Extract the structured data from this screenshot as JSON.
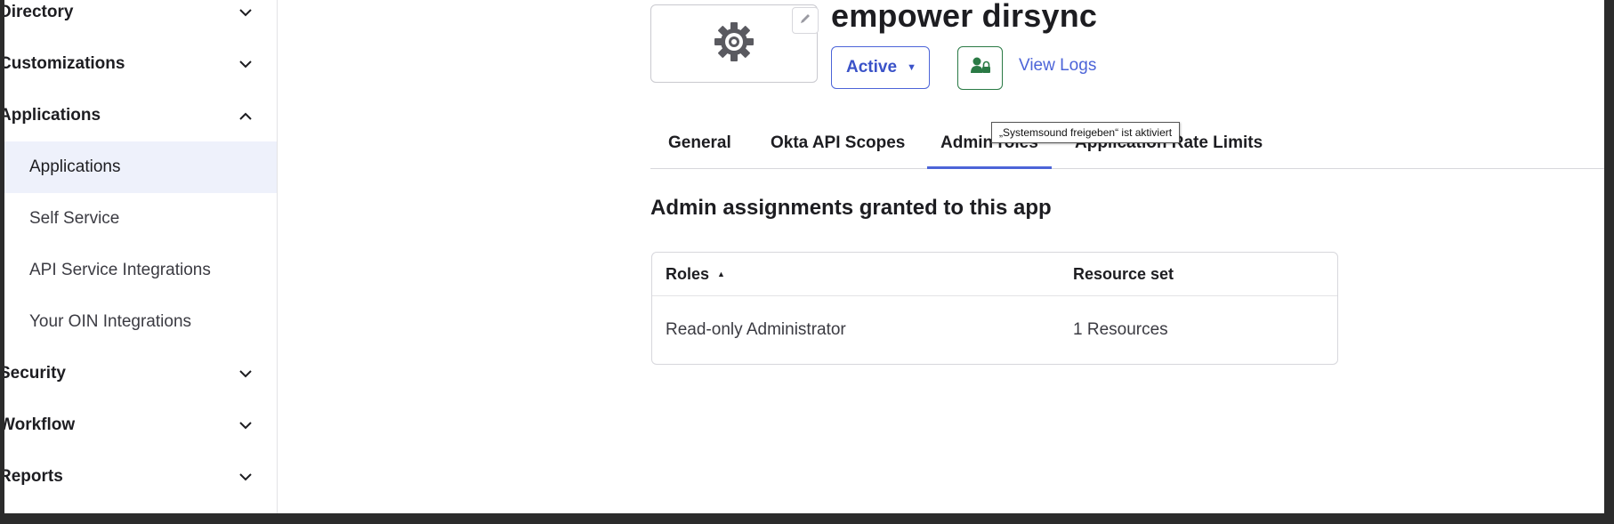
{
  "sidebar": {
    "sections": [
      {
        "label": "Directory",
        "expanded": false
      },
      {
        "label": "Customizations",
        "expanded": false
      },
      {
        "label": "Applications",
        "expanded": true
      },
      {
        "label": "Security",
        "expanded": false
      },
      {
        "label": "Workflow",
        "expanded": false
      },
      {
        "label": "Reports",
        "expanded": false
      }
    ],
    "applications_items": [
      {
        "label": "Applications",
        "active": true
      },
      {
        "label": "Self Service"
      },
      {
        "label": "API Service Integrations"
      },
      {
        "label": "Your OIN Integrations"
      }
    ]
  },
  "app": {
    "title": "empower dirsync",
    "logo_icon": "gear-icon",
    "status": "Active",
    "view_logs": "View Logs"
  },
  "tabs": [
    {
      "label": "General"
    },
    {
      "label": "Okta API Scopes"
    },
    {
      "label": "Admin roles",
      "active": true
    },
    {
      "label": "Application Rate Limits"
    }
  ],
  "tooltip": "„Systemsound freigeben“ ist aktiviert",
  "section_title": "Admin assignments granted to this app",
  "table": {
    "headers": {
      "roles": "Roles",
      "resource_set": "Resource set"
    },
    "rows": [
      {
        "role": "Read-only Administrator",
        "resource_set": "1 Resources"
      }
    ]
  },
  "colors": {
    "accent": "#4c64d8",
    "active_nav_bg": "#eef1fb",
    "provision_green": "#2a7a45"
  }
}
